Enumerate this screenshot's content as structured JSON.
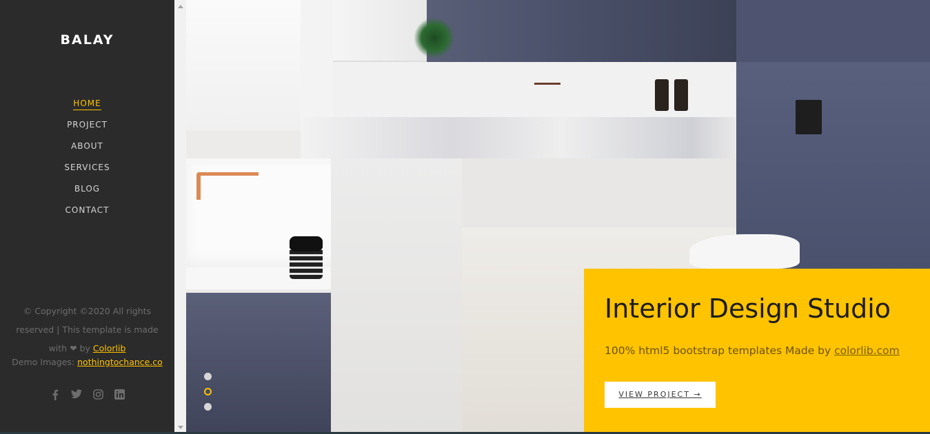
{
  "sidebar": {
    "brand": "BALAY",
    "nav": [
      {
        "label": "HOME",
        "active": true
      },
      {
        "label": "PROJECT",
        "active": false
      },
      {
        "label": "ABOUT",
        "active": false
      },
      {
        "label": "SERVICES",
        "active": false
      },
      {
        "label": "BLOG",
        "active": false
      },
      {
        "label": "CONTACT",
        "active": false
      }
    ],
    "footer": {
      "copyright_line1": "© Copyright ©2020 All rights",
      "copyright_line2": "reserved | This template is made",
      "with": "with",
      "heart": "❤",
      "by": "by",
      "colorlib": "Colorlib",
      "demo_label": "Demo Images:",
      "demo_link": "nothingtochance.co"
    },
    "social_icons": [
      "facebook-icon",
      "twitter-icon",
      "instagram-icon",
      "linkedin-icon"
    ]
  },
  "hero": {
    "title": "Interior Design Studio",
    "subtitle_prefix": "100% html5 bootstrap templates Made by",
    "subtitle_link": "colorlib.com",
    "button_label": "VIEW PROJECT",
    "button_arrow": "→",
    "slides_count": 3,
    "active_slide": 2
  },
  "colors": {
    "accent": "#ffc300",
    "sidebar_bg": "#2b2b2b"
  }
}
